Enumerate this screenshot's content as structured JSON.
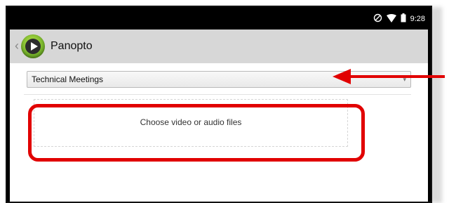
{
  "status_bar": {
    "time": "9:28",
    "icons": [
      "do-not-disturb-icon",
      "wifi-icon",
      "battery-icon"
    ]
  },
  "app_bar": {
    "title": "Panopto",
    "logo_icon": "panopto-logo-icon",
    "back_icon": "back-chevron-icon"
  },
  "folder_select": {
    "selected": "Technical Meetings"
  },
  "upload": {
    "label": "Choose video or audio files"
  },
  "colors": {
    "annotation_red": "#e10000",
    "app_bar_bg": "#d7d7d7",
    "logo_green": "#7bb82d"
  }
}
